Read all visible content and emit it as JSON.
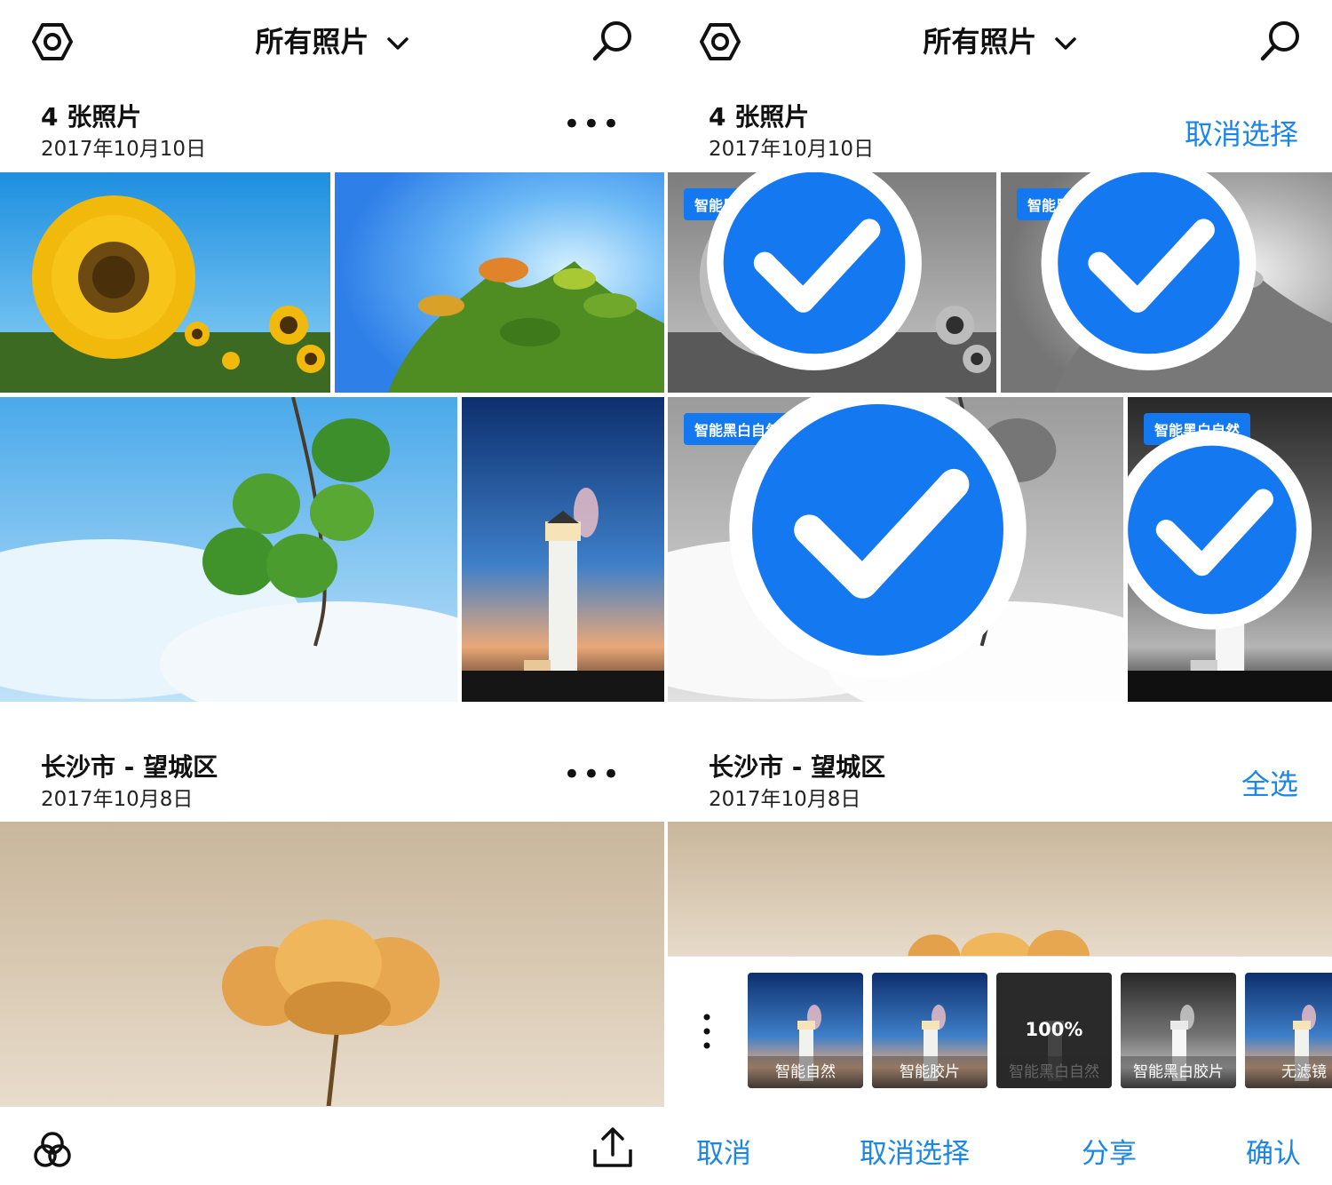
{
  "left": {
    "header": {
      "title": "所有照片",
      "icons": [
        "gear-icon",
        "chevron-down-icon",
        "search-icon"
      ]
    },
    "section1": {
      "heading": "4 张照片",
      "date": "2017年10月10日",
      "more": "•••"
    },
    "section2": {
      "heading": "长沙市 - 望城区",
      "date": "2017年10月8日",
      "more": "•••"
    },
    "bottombar": {
      "icons": [
        "filters-icon",
        "share-icon"
      ]
    }
  },
  "right": {
    "header": {
      "title": "所有照片",
      "icons": [
        "gear-icon",
        "chevron-down-icon",
        "search-icon"
      ]
    },
    "section1": {
      "heading": "4 张照片",
      "date": "2017年10月10日",
      "action": "取消选择"
    },
    "section2": {
      "heading": "长沙市 - 望城区",
      "date": "2017年10月8日",
      "action": "全选"
    },
    "badge": "智能黑白自然",
    "filters": [
      {
        "label": "智能自然"
      },
      {
        "label": "智能胶片"
      },
      {
        "label": "智能黑白自然",
        "value": "100%"
      },
      {
        "label": "智能黑白胶片"
      },
      {
        "label": "无滤镜"
      }
    ],
    "actions": {
      "cancel": "取消",
      "deselect": "取消选择",
      "share": "分享",
      "confirm": "确认"
    }
  },
  "colors": {
    "accent": "#1a86e8",
    "badge": "#1478f0"
  }
}
